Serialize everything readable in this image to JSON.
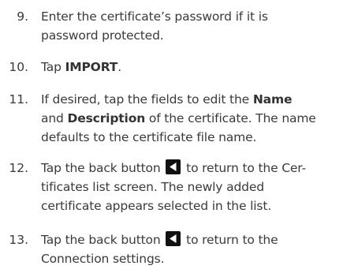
{
  "steps": [
    {
      "number": "9.",
      "lines": [
        "Enter the certificate’s password if it is",
        "password protected."
      ]
    },
    {
      "number": "10.",
      "pre": "Tap ",
      "bold": "IMPORT",
      "post": "."
    },
    {
      "number": "11.",
      "l1_pre": "If desired, tap the fields to edit the ",
      "l1_bold": "Name",
      "l2_pre": "and ",
      "l2_bold": "Description",
      "l2_post": " of the certificate. The name",
      "l3": "defaults to the certificate file name."
    },
    {
      "number": "12.",
      "l1_pre": "Tap the back button ",
      "l1_post": " to return to the Cer-",
      "l2": "tificates list screen. The newly added",
      "l3": "certificate appears selected in the list."
    },
    {
      "number": "13.",
      "l1_pre": "Tap the back button ",
      "l1_post": " to return to the",
      "l2": "Connection settings."
    }
  ],
  "icons": {
    "back": "back-arrow-icon"
  }
}
